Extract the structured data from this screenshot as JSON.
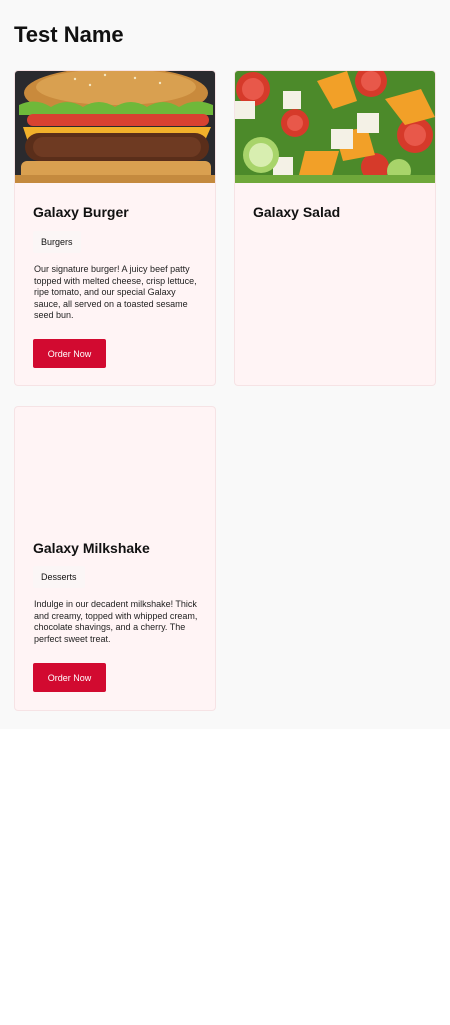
{
  "page": {
    "title": "Test Name"
  },
  "cards": [
    {
      "title": "Galaxy Burger",
      "category": "Burgers",
      "description": "Our signature burger! A juicy beef patty topped with melted cheese, crisp lettuce, ripe tomato, and our special Galaxy sauce, all served on a toasted sesame seed bun.",
      "button_label": "Order Now"
    },
    {
      "title": "Galaxy Salad"
    },
    {
      "title": "Galaxy Milkshake",
      "category": "Desserts",
      "description": "Indulge in our decadent milkshake! Thick and creamy, topped with whipped cream, chocolate shavings, and a cherry. The perfect sweet treat.",
      "button_label": "Order Now"
    }
  ],
  "colors": {
    "accent": "#d20a30",
    "card_bg": "#fff4f5",
    "page_bg": "#f9f9f9"
  }
}
